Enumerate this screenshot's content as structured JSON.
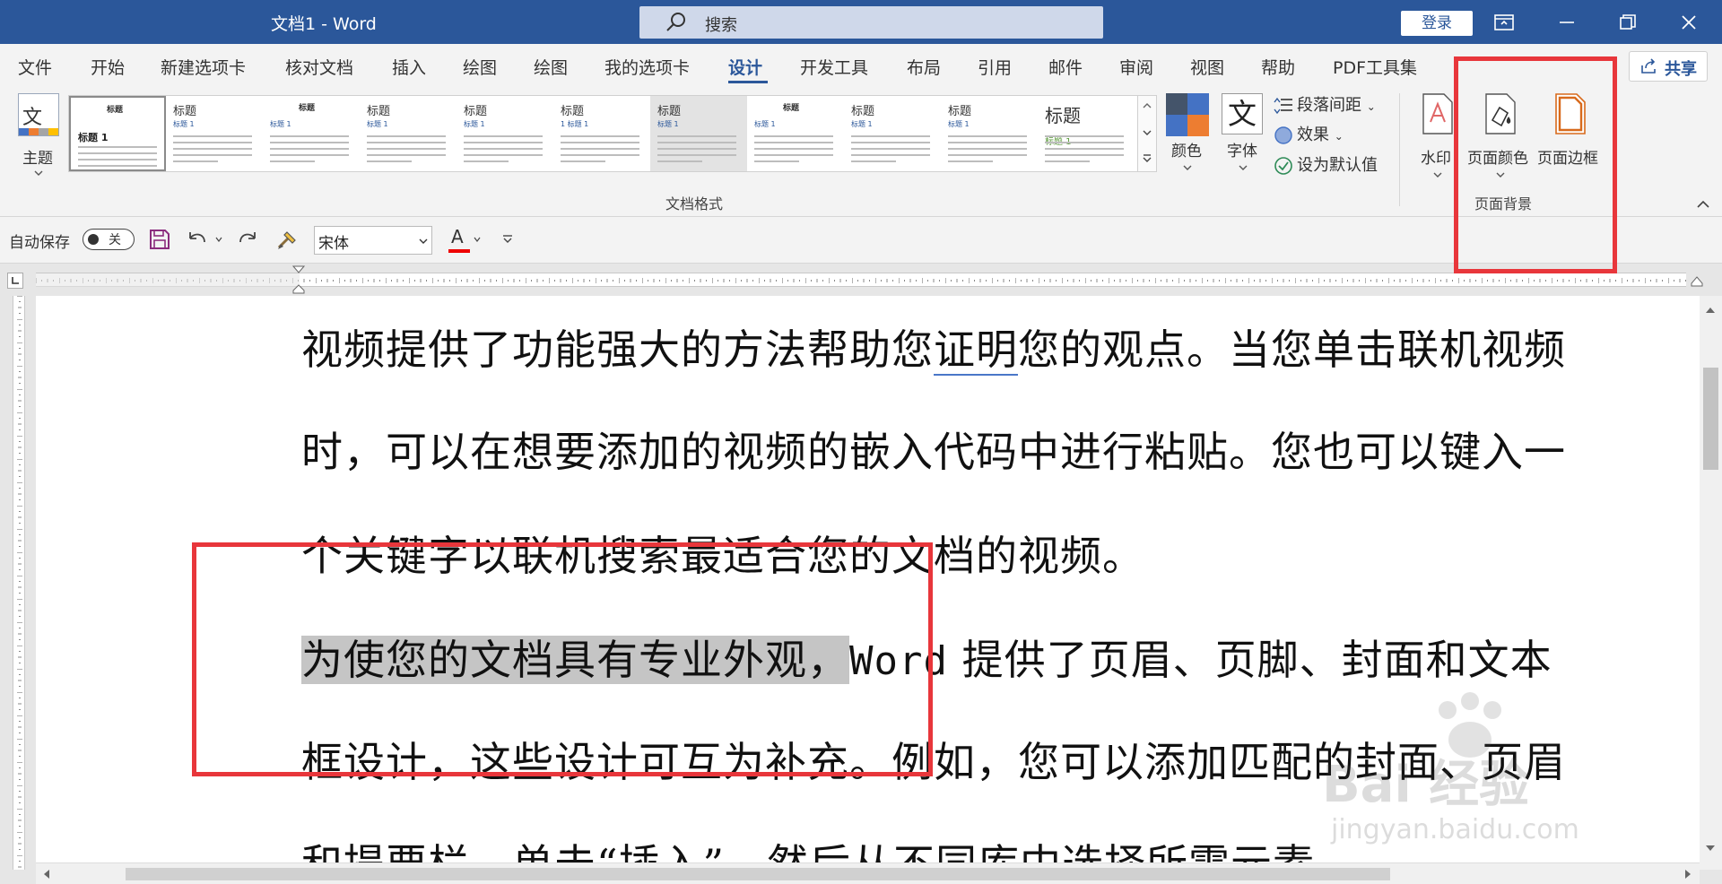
{
  "window": {
    "title": "文档1  -  Word",
    "search_placeholder": "搜索",
    "login": "登录"
  },
  "tabs": [
    "文件",
    "开始",
    "新建选项卡",
    "核对文档",
    "插入",
    "绘图",
    "绘图",
    "我的选项卡",
    "设计",
    "开发工具",
    "布局",
    "引用",
    "邮件",
    "审阅",
    "视图",
    "帮助",
    "PDF工具集"
  ],
  "active_tab": "设计",
  "share": "共享",
  "ribbon": {
    "theme_label": "主题",
    "style_gallery": [
      {
        "title": "标题",
        "sub": "标题 1"
      },
      {
        "title": "标题",
        "sub": "标题 1"
      },
      {
        "title": "标题",
        "sub": "标题 1"
      },
      {
        "title": "标题",
        "sub": "标题 1"
      },
      {
        "title": "标题",
        "sub": "标题 1"
      },
      {
        "title": "标题",
        "sub": "1  标题 1"
      },
      {
        "title": "标题",
        "sub": "标题 1"
      },
      {
        "title": "标题",
        "sub": "标题 1"
      },
      {
        "title": "标题",
        "sub": "标题 1"
      },
      {
        "title": "标题",
        "sub": "标题 1"
      },
      {
        "title": "标题",
        "sub": "标题 1"
      }
    ],
    "doc_format_group": "文档格式",
    "colors_label": "颜色",
    "fonts_label": "字体",
    "font_icon_char": "文",
    "paragraph_spacing": "段落间距",
    "effects": "效果",
    "set_default": "设为默认值",
    "watermark": "水印",
    "page_color": "页面颜色",
    "page_borders": "页面边框",
    "page_background_group": "页面背景"
  },
  "qat": {
    "autosave": "自动保存",
    "toggle_state": "关",
    "font_name": "宋体",
    "font_color_letter": "A"
  },
  "document": {
    "line1_a": "视频提供了功能强大的方法帮助您",
    "line1_grammar": "证明",
    "line1_b": "您的观点。当您单击联机视频",
    "line2": "时，可以在想要添加的视频的嵌入代码中进行粘贴。您也可以键入一",
    "line3": "个关键字以联机搜索最适合您的文档的视频。",
    "line4_selected": "为使您的文档具有专业外观，",
    "line4_latin": "Word",
    "line4_rest": " 提供了页眉、页脚、封面和文本",
    "line5": "框设计，这些设计可互为补充。例如，您可以添加匹配的封面、页眉",
    "line6": "和提要栏。单击“插入”，然后从不同库中选择所需元素。"
  },
  "watermark_text": {
    "brand": "Bai 经验",
    "url": "jingyan.baidu.com"
  },
  "colors": {
    "accent": "#2b579a",
    "highlight_box": "#e8363b",
    "selection": "#c5c5c5"
  }
}
